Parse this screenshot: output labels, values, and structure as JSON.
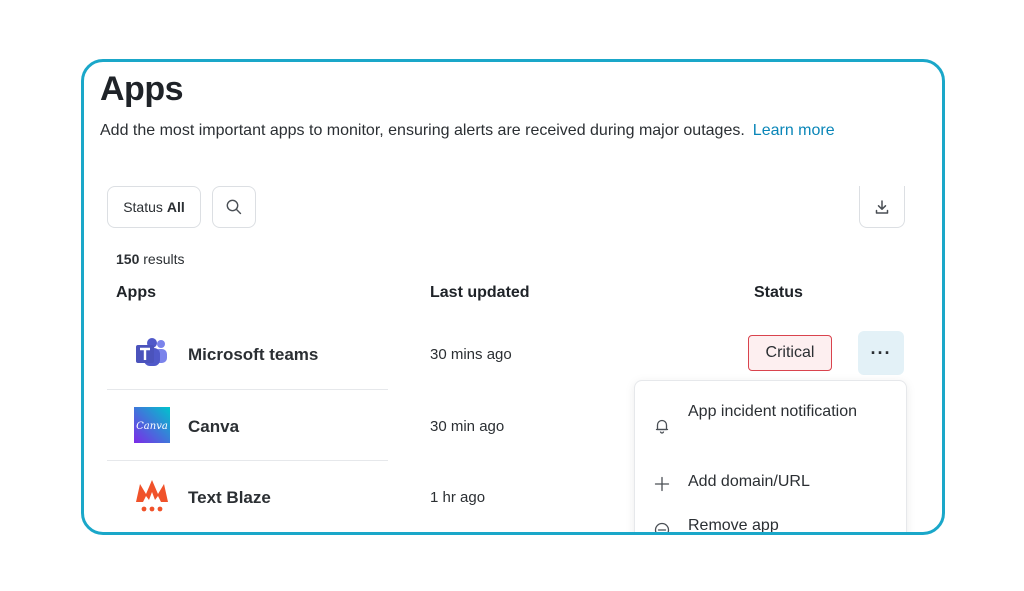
{
  "page": {
    "title": "Apps",
    "subtitle": "Add the most important apps to monitor, ensuring alerts are received during major outages.",
    "learn_more": "Learn more"
  },
  "filters": {
    "status_label": "Status",
    "status_value": "All"
  },
  "results": {
    "count": "150",
    "label": "results"
  },
  "table": {
    "headers": [
      "Apps",
      "Last updated",
      "Status"
    ],
    "rows": [
      {
        "icon": "microsoft-teams-logo",
        "name": "Microsoft teams",
        "updated": "30 mins ago",
        "status": "Critical"
      },
      {
        "icon": "canva-logo",
        "name": "Canva",
        "updated": "30 min ago",
        "status": ""
      },
      {
        "icon": "text-blaze-logo",
        "name": "Text Blaze",
        "updated": "1 hr ago",
        "status": ""
      }
    ]
  },
  "canva_logo_text": "Canva",
  "more_button": "···",
  "menu": {
    "items": [
      {
        "icon": "bell-icon",
        "label": "App incident notification"
      },
      {
        "icon": "plus-icon",
        "label": "Add domain/URL"
      },
      {
        "icon": "minus-circle-icon",
        "label": "Remove app"
      }
    ]
  },
  "colors": {
    "frame": "#1aa7c9",
    "link": "#0a86b8",
    "critical_border": "#d9434d",
    "critical_bg": "#fdeff0",
    "more_button_bg": "#e3f1f7"
  }
}
